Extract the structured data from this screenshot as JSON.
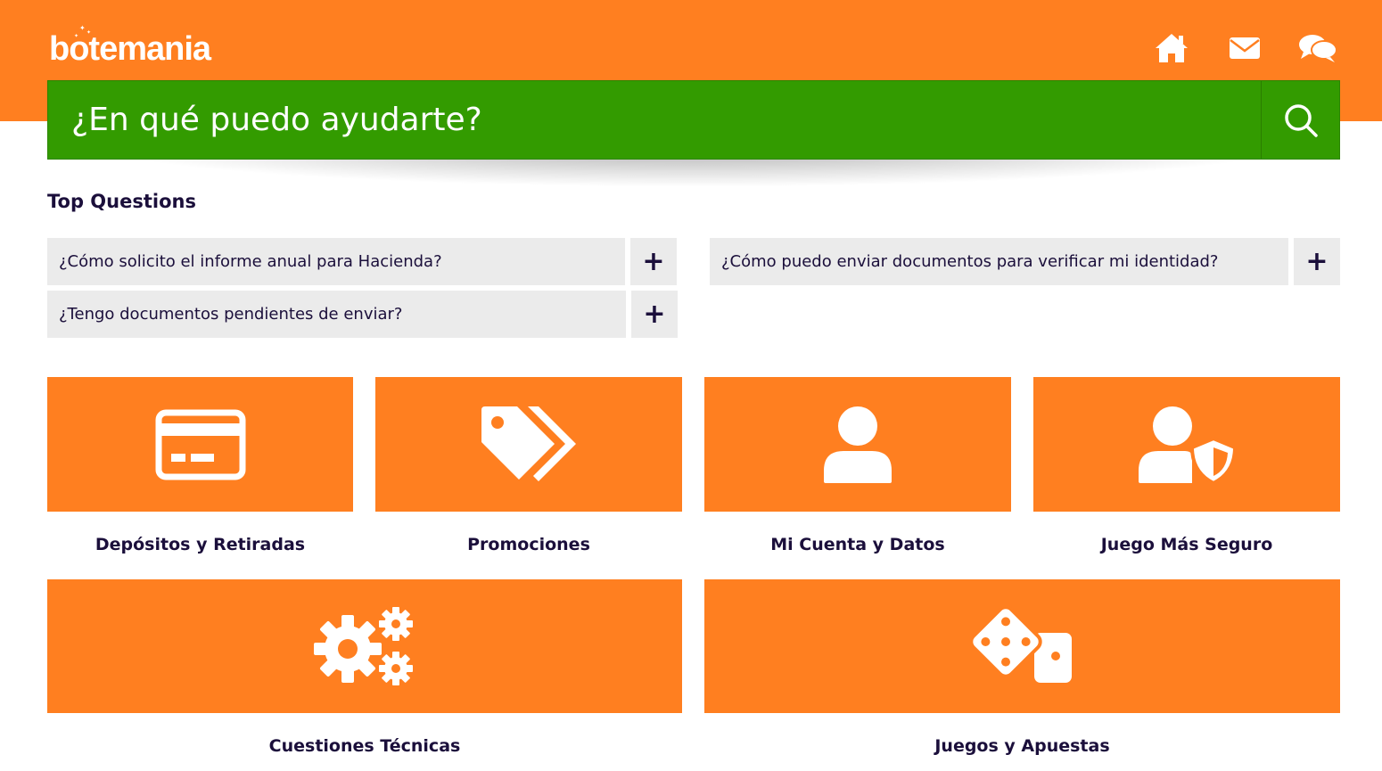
{
  "brand": {
    "logo_text": "botemania"
  },
  "header": {
    "icons": [
      "home-icon",
      "mail-icon",
      "chat-icon"
    ]
  },
  "search": {
    "placeholder": "¿En qué puedo ayudarte?"
  },
  "top_questions": {
    "title": "Top Questions",
    "items": [
      {
        "question": "¿Cómo solicito el informe anual para Hacienda?",
        "toggle": "+"
      },
      {
        "question": "¿Cómo puedo enviar documentos para verificar mi identidad?",
        "toggle": "+"
      },
      {
        "question": "¿Tengo documentos pendientes de enviar?",
        "toggle": "+"
      }
    ]
  },
  "categories": [
    {
      "label": "Depósitos y Retiradas",
      "icon": "credit-card-icon"
    },
    {
      "label": "Promociones",
      "icon": "tags-icon"
    },
    {
      "label": "Mi Cuenta y Datos",
      "icon": "user-icon"
    },
    {
      "label": "Juego Más Seguro",
      "icon": "user-shield-icon"
    },
    {
      "label": "Cuestiones Técnicas",
      "icon": "cogs-icon"
    },
    {
      "label": "Juegos y Apuestas",
      "icon": "dice-icon"
    }
  ],
  "colors": {
    "brand_orange": "#ff7f20",
    "search_green": "#339b00",
    "text_dark": "#1b0f3b",
    "faq_bg": "#ebebeb"
  }
}
